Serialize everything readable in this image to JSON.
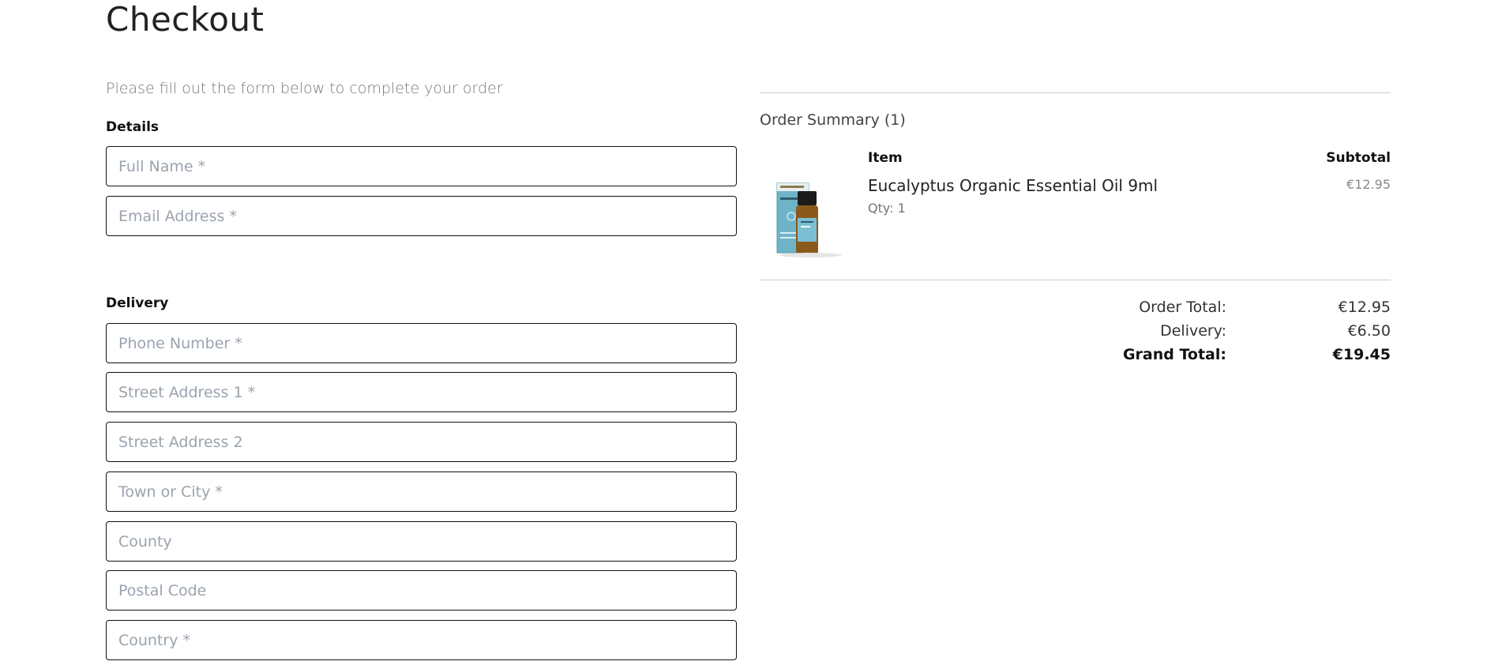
{
  "page": {
    "title": "Checkout",
    "subtitle": "Please fill out the form below to complete your order"
  },
  "details": {
    "label": "Details",
    "fields": {
      "full_name": "Full Name *",
      "email": "Email Address *"
    }
  },
  "delivery": {
    "label": "Delivery",
    "fields": {
      "phone": "Phone Number *",
      "street1": "Street Address 1 *",
      "street2": "Street Address 2",
      "town": "Town or City *",
      "county": "County",
      "postal": "Postal Code",
      "country": "Country *"
    }
  },
  "summary": {
    "title": "Order Summary (1)",
    "col_item": "Item",
    "col_subtotal": "Subtotal",
    "items": [
      {
        "name": "Eucalyptus Organic Essential Oil 9ml",
        "qty": "Qty: 1",
        "price": "€12.95",
        "image": "essential-oil-bottle-image"
      }
    ],
    "totals": {
      "order_total_label": "Order Total:",
      "order_total_value": "€12.95",
      "delivery_label": "Delivery:",
      "delivery_value": "€6.50",
      "grand_total_label": "Grand Total:",
      "grand_total_value": "€19.45"
    }
  }
}
